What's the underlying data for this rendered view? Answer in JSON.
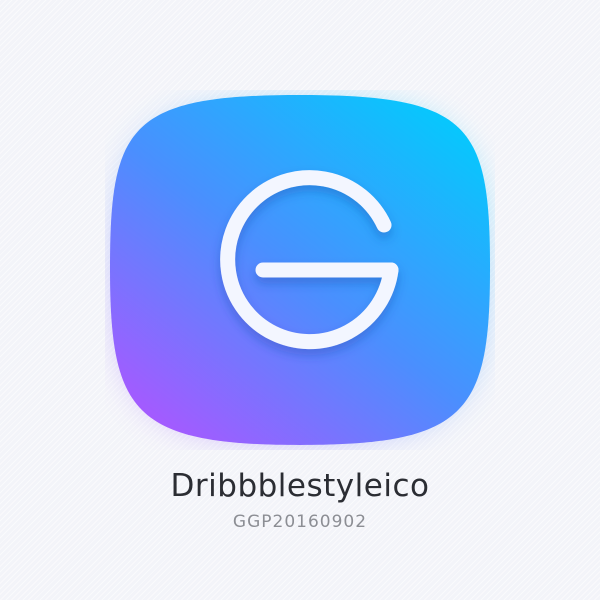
{
  "app": {
    "name": "Dribbblestyleico",
    "code": "GGP20160902"
  },
  "icon": {
    "symbol": "letter-g-icon",
    "gradient": [
      "#08c6fd",
      "#4a8ffe",
      "#a858ff"
    ],
    "stroke_color": "#f3f6ff"
  }
}
